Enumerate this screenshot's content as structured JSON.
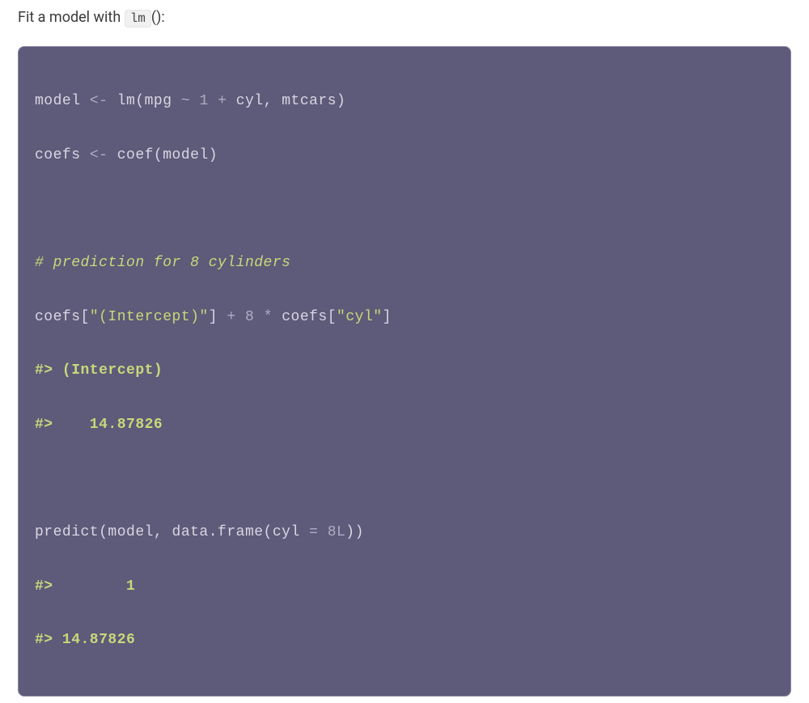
{
  "prose": {
    "before": "Fit a model with ",
    "inline_code": "lm",
    "after": "():"
  },
  "code": {
    "l1": {
      "a": "model ",
      "op1": "<-",
      "b": " lm(mpg ",
      "op2": "~",
      "c": " ",
      "num1": "1",
      "d": " ",
      "op3": "+",
      "e": " cyl, mtcars)"
    },
    "l2": {
      "a": "coefs ",
      "op1": "<-",
      "b": " coef(model)"
    },
    "l3": "",
    "l4": {
      "cmt": "# prediction for 8 cylinders"
    },
    "l5": {
      "a": "coefs[",
      "str1": "\"(Intercept)\"",
      "b": "] ",
      "op1": "+",
      "c": " ",
      "num1": "8",
      "d": " ",
      "op2": "*",
      "e": " coefs[",
      "str2": "\"cyl\"",
      "f": "]"
    },
    "l6": {
      "out": "#> (Intercept) "
    },
    "l7": {
      "out": "#>    14.87826"
    },
    "l8": "",
    "l9": {
      "a": "predict(model, data.frame(cyl ",
      "op1": "=",
      "b": " ",
      "num1": "8L",
      "c": "))"
    },
    "l10": {
      "out": "#>        1 "
    },
    "l11": {
      "out": "#> 14.87826"
    }
  }
}
